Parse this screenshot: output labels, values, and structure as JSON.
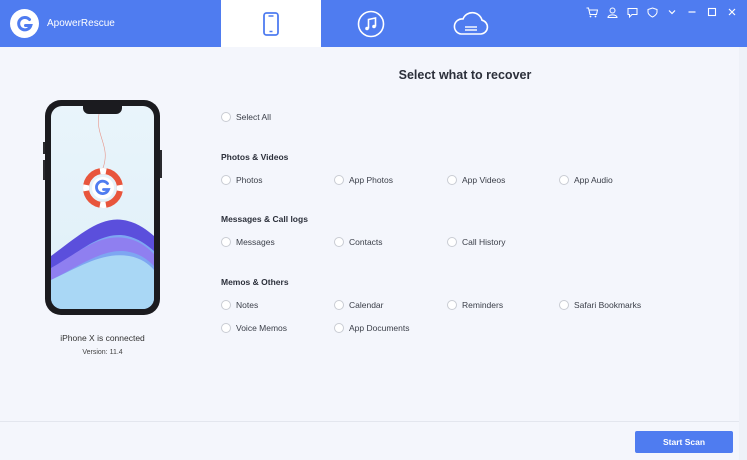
{
  "app": {
    "name": "ApowerRescue"
  },
  "tabs": [
    {
      "name": "device",
      "icon": "phone-icon",
      "active": true
    },
    {
      "name": "itunes",
      "icon": "music-icon",
      "active": false
    },
    {
      "name": "icloud",
      "icon": "cloud-icon",
      "active": false
    }
  ],
  "window_controls": [
    "cart-icon",
    "user-icon",
    "feedback-icon",
    "shield-icon",
    "chevron-down-icon",
    "minimize-icon",
    "maximize-icon",
    "close-icon"
  ],
  "device": {
    "status": "iPhone X is connected",
    "version": "Version: 11.4"
  },
  "main": {
    "heading": "Select what to recover",
    "select_all": "Select All",
    "sections": [
      {
        "title": "Photos & Videos",
        "options": [
          "Photos",
          "App Photos",
          "App Videos",
          "App Audio"
        ]
      },
      {
        "title": "Messages & Call logs",
        "options": [
          "Messages",
          "Contacts",
          "Call History"
        ]
      },
      {
        "title": "Memos & Others",
        "options": [
          "Notes",
          "Calendar",
          "Reminders",
          "Safari Bookmarks",
          "Voice Memos",
          "App Documents"
        ]
      }
    ]
  },
  "footer": {
    "start_scan": "Start Scan"
  },
  "colors": {
    "accent": "#4f7cf0",
    "background": "#f4f6fc",
    "logo_red": "#e8553c"
  }
}
